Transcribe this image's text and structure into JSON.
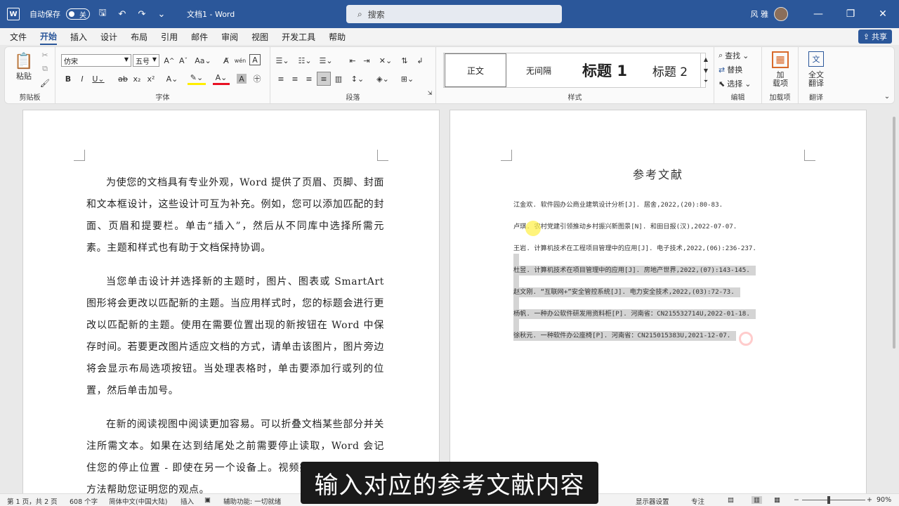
{
  "titlebar": {
    "app_icon": "W",
    "autosave_label": "自动保存",
    "autosave_state": "关",
    "doc_title": "文档1  -  Word",
    "search_placeholder": "搜索",
    "user_name": "风 雅"
  },
  "menu": {
    "tabs": [
      "文件",
      "开始",
      "插入",
      "设计",
      "布局",
      "引用",
      "邮件",
      "审阅",
      "视图",
      "开发工具",
      "帮助"
    ],
    "active": "开始",
    "share_label": "共享"
  },
  "ribbon": {
    "clipboard": {
      "paste_label": "粘贴",
      "group_label": "剪贴板"
    },
    "font": {
      "font_name": "仿宋",
      "font_size": "五号",
      "group_label": "字体"
    },
    "paragraph": {
      "group_label": "段落"
    },
    "styles": {
      "items": [
        "正文",
        "无间隔",
        "标题 1",
        "标题 2"
      ],
      "selected": "正文",
      "group_label": "样式"
    },
    "editing": {
      "find": "查找",
      "replace": "替换",
      "select": "选择",
      "group_label": "编辑"
    },
    "addins": {
      "label_line1": "加",
      "label_line2": "载项",
      "group_label": "加载项"
    },
    "translate": {
      "label_line1": "全文",
      "label_line2": "翻译",
      "group_label": "翻译"
    }
  },
  "left_page": {
    "paragraphs": [
      "为使您的文档具有专业外观，Word 提供了页眉、页脚、封面和文本框设计，这些设计可互为补充。例如，您可以添加匹配的封面、页眉和提要栏。单击“插入”，然后从不同库中选择所需元素。主题和样式也有助于文档保持协调。",
      "当您单击设计并选择新的主题时，图片、图表或 SmartArt 图形将会更改以匹配新的主题。当应用样式时，您的标题会进行更改以匹配新的主题。使用在需要位置出现的新按钮在 Word 中保存时间。若要更改图片适应文档的方式，请单击该图片，图片旁边将会显示布局选项按钮。当处理表格时，单击要添加行或列的位置，然后单击加号。",
      "在新的阅读视图中阅读更加容易。可以折叠文档某些部分并关注所需文本。如果在达到结尾处之前需要停止读取，Word 会记住您的停止位置 - 即使在另一个设备上。视频提供了功能强大的方法帮助您证明您的观点。"
    ]
  },
  "right_page": {
    "title": "参考文献",
    "references": [
      "江金欢. 软件园办公商业建筑设计分析[J]. 居舍,2022,(20):80-83.",
      "卢琪. 农村党建引领推动乡村振兴新图景[N]. 和田日报(汉),2022-07-07.",
      "王岩. 计算机技术在工程项目管理中的应用[J]. 电子技术,2022,(06):236-237.",
      "杜昱. 计算机技术在项目管理中的应用[J]. 房地产世界,2022,(07):143-145.",
      "赵文刚. “互联网+”安全管控系统[J]. 电力安全技术,2022,(03):72-73.",
      "杨帆. 一种办公软件研发用资料柜[P]. 河南省：CN215532714U,2022-01-18.",
      "徐秋元. 一种软件办公座椅[P]. 河南省：CN215015383U,2021-12-07."
    ],
    "highlighted_from_index": 3
  },
  "statusbar": {
    "page": "第 1 页，共 2 页",
    "words": "608 个字",
    "language": "简体中文(中国大陆)",
    "mode": "插入",
    "accessibility": "辅助功能: 一切就绪",
    "display_settings": "显示器设置",
    "focus": "专注",
    "zoom": "90%"
  },
  "caption": "输入对应的参考文献内容",
  "colors": {
    "accent": "#2b579a",
    "highlight": "#d4d4d4"
  }
}
